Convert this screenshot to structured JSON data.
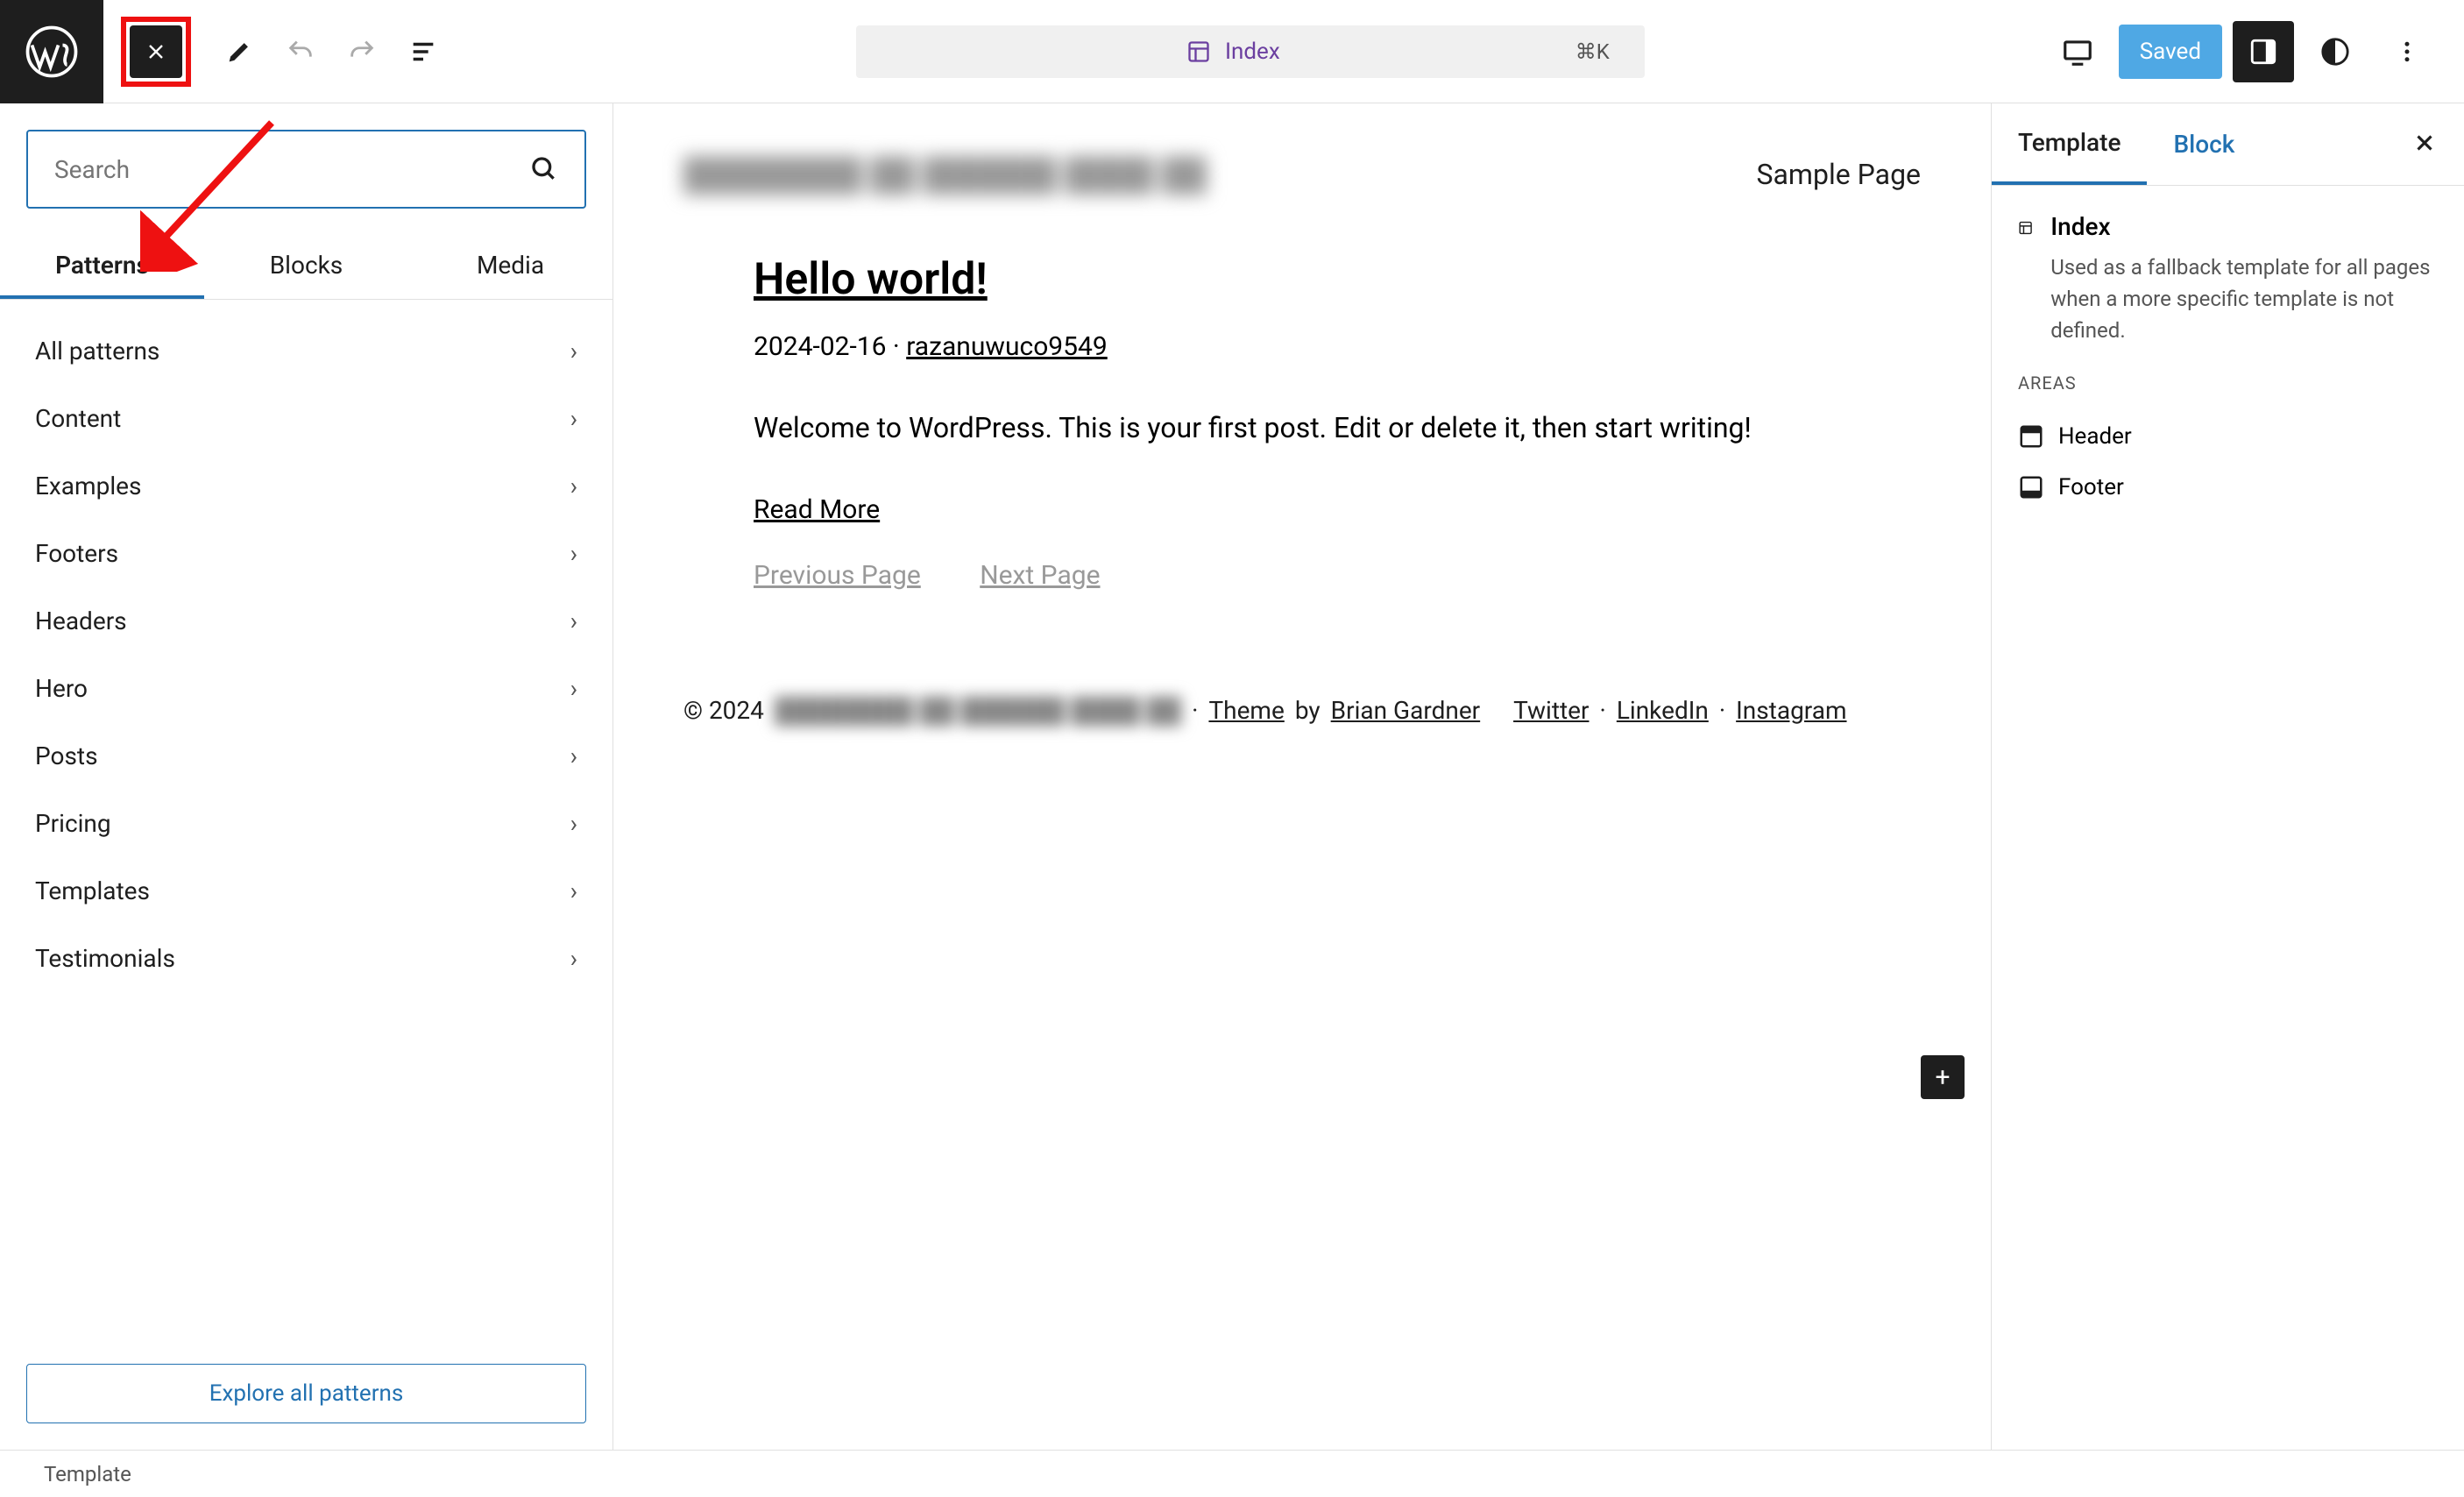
{
  "topbar": {
    "command_title": "Index",
    "command_shortcut": "⌘K",
    "saved_label": "Saved"
  },
  "sidebar": {
    "search_placeholder": "Search",
    "tabs": [
      "Patterns",
      "Blocks",
      "Media"
    ],
    "categories": [
      "All patterns",
      "Content",
      "Examples",
      "Footers",
      "Headers",
      "Hero",
      "Posts",
      "Pricing",
      "Templates",
      "Testimonials"
    ],
    "explore_label": "Explore all patterns"
  },
  "canvas": {
    "sample_page": "Sample Page",
    "post_title": "Hello world!",
    "post_date": "2024-02-16",
    "post_author": "razanuwuco9549",
    "post_content": "Welcome to WordPress. This is your first post. Edit or delete it, then start writing!",
    "read_more": "Read More",
    "prev_page": "Previous Page",
    "next_page": "Next Page",
    "copyright": "© 2024",
    "theme_word": "Theme",
    "by_word": " by ",
    "designer": "Brian Gardner",
    "social": [
      "Twitter",
      "LinkedIn",
      "Instagram"
    ]
  },
  "inspector": {
    "tabs": [
      "Template",
      "Block"
    ],
    "template_name": "Index",
    "template_desc": "Used as a fallback template for all pages when a more specific template is not defined.",
    "areas_label": "AREAS",
    "areas": [
      "Header",
      "Footer"
    ]
  },
  "footer": {
    "breadcrumb": "Template"
  }
}
